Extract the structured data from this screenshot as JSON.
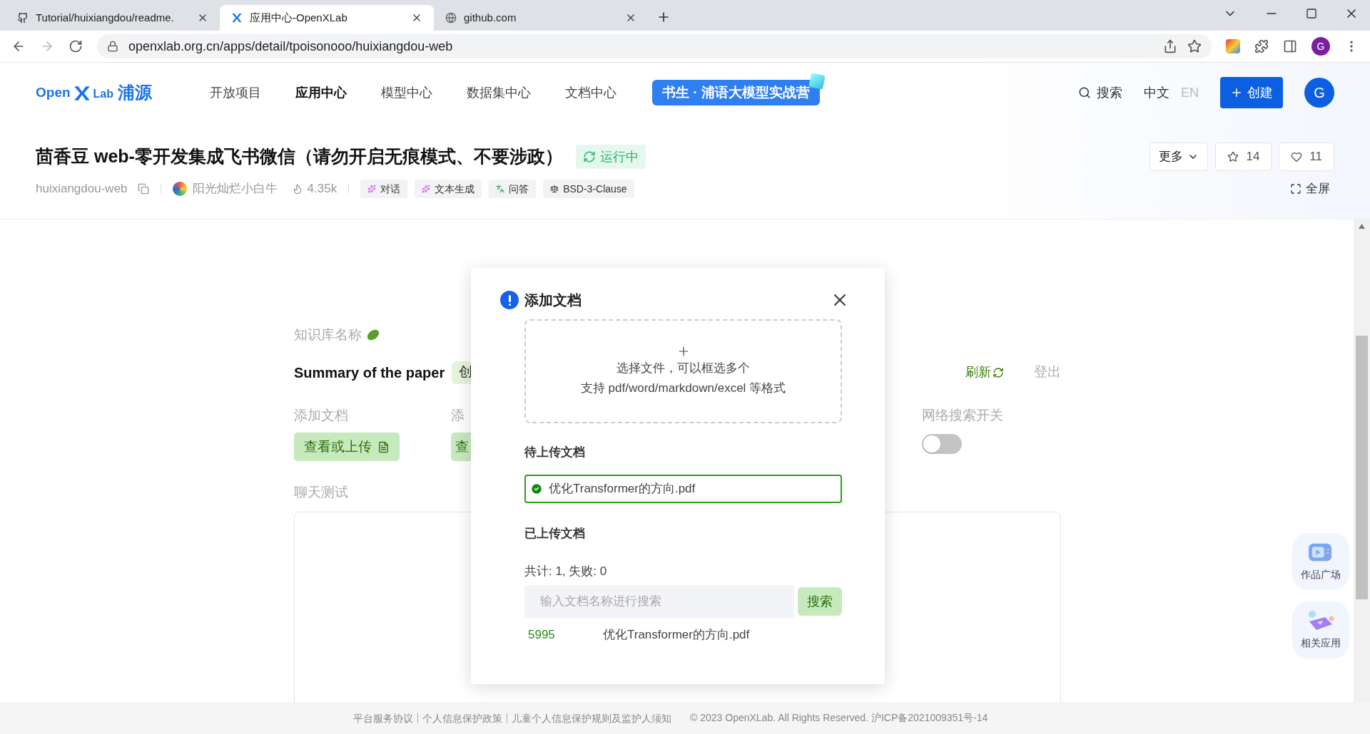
{
  "browser": {
    "tabs": [
      {
        "title": "Tutorial/huixiangdou/readme.",
        "selected": false
      },
      {
        "title": "应用中心-OpenXLab",
        "selected": true
      },
      {
        "title": "github.com",
        "selected": false
      }
    ],
    "url": "openxlab.org.cn/apps/detail/tpoisonooo/huixiangdou-web",
    "profile": "G"
  },
  "site": {
    "logo": {
      "word_1": "Open",
      "word_2": "Lab",
      "word_3": "浦源"
    },
    "nav": [
      {
        "label": "开放项目",
        "selected": false
      },
      {
        "label": "应用中心",
        "selected": true
      },
      {
        "label": "模型中心",
        "selected": false
      },
      {
        "label": "数据集中心",
        "selected": false
      },
      {
        "label": "文档中心",
        "selected": false
      }
    ],
    "banner": "书生 · 浦语大模型实战营",
    "search": "搜索",
    "languages": [
      {
        "label": "中文",
        "selected": true
      },
      {
        "label": "EN",
        "selected": false
      }
    ],
    "create": "创建",
    "avatar": "G"
  },
  "app": {
    "title": "茴香豆 web-零开发集成飞书微信（请勿开启无痕模式、不要涉政）",
    "status": "运行中",
    "more": "更多",
    "stars": "14",
    "likes": "11",
    "slug": "huixiangdou-web",
    "author": "阳光灿烂小白牛",
    "views": "4.35k",
    "tags": [
      {
        "label": "对话",
        "kind": "sparkle"
      },
      {
        "label": "文本生成",
        "kind": "sparkle"
      },
      {
        "label": "问答",
        "kind": "translate"
      },
      {
        "label": "BSD-3-Clause",
        "kind": "license"
      }
    ],
    "fullscreen": "全屏"
  },
  "content": {
    "kb_label": "知识库名称",
    "kb_name": "Summary of the paper",
    "kb_chip": "创",
    "add_doc_label": "添加文档",
    "upload_button": "查看或上传",
    "second_label": "添",
    "second_button": "查",
    "refresh": "刷新",
    "logout": "登出",
    "web_search_label": "网络搜索开关",
    "web_search": {
      "on": false
    },
    "chat_label": "聊天测试"
  },
  "modal": {
    "title": "添加文档",
    "dropzone": {
      "line_1": "选择文件，可以框选多个",
      "line_2": "支持 pdf/word/markdown/excel 等格式"
    },
    "pending_title": "待上传文档",
    "pending": [
      {
        "name": "优化Transformer的方向.pdf",
        "done": true
      }
    ],
    "uploaded_title": "已上传文档",
    "summary": "共计: 1, 失败: 0",
    "search": {
      "placeholder": "输入文档名称进行搜索",
      "button": "搜索"
    },
    "rows": [
      {
        "id": "5995",
        "name": "优化Transformer的方向.pdf"
      }
    ]
  },
  "floating": [
    {
      "label": "作品广场",
      "kind": "gallery"
    },
    {
      "label": "相关应用",
      "kind": "apps"
    }
  ],
  "footer": {
    "links": [
      "平台服务协议",
      "个人信息保护政策",
      "儿童个人信息保护规则及监护人须知"
    ],
    "copyright": "© 2023 OpenXLab. All Rights Reserved. 沪ICP备2021009351号-14"
  }
}
